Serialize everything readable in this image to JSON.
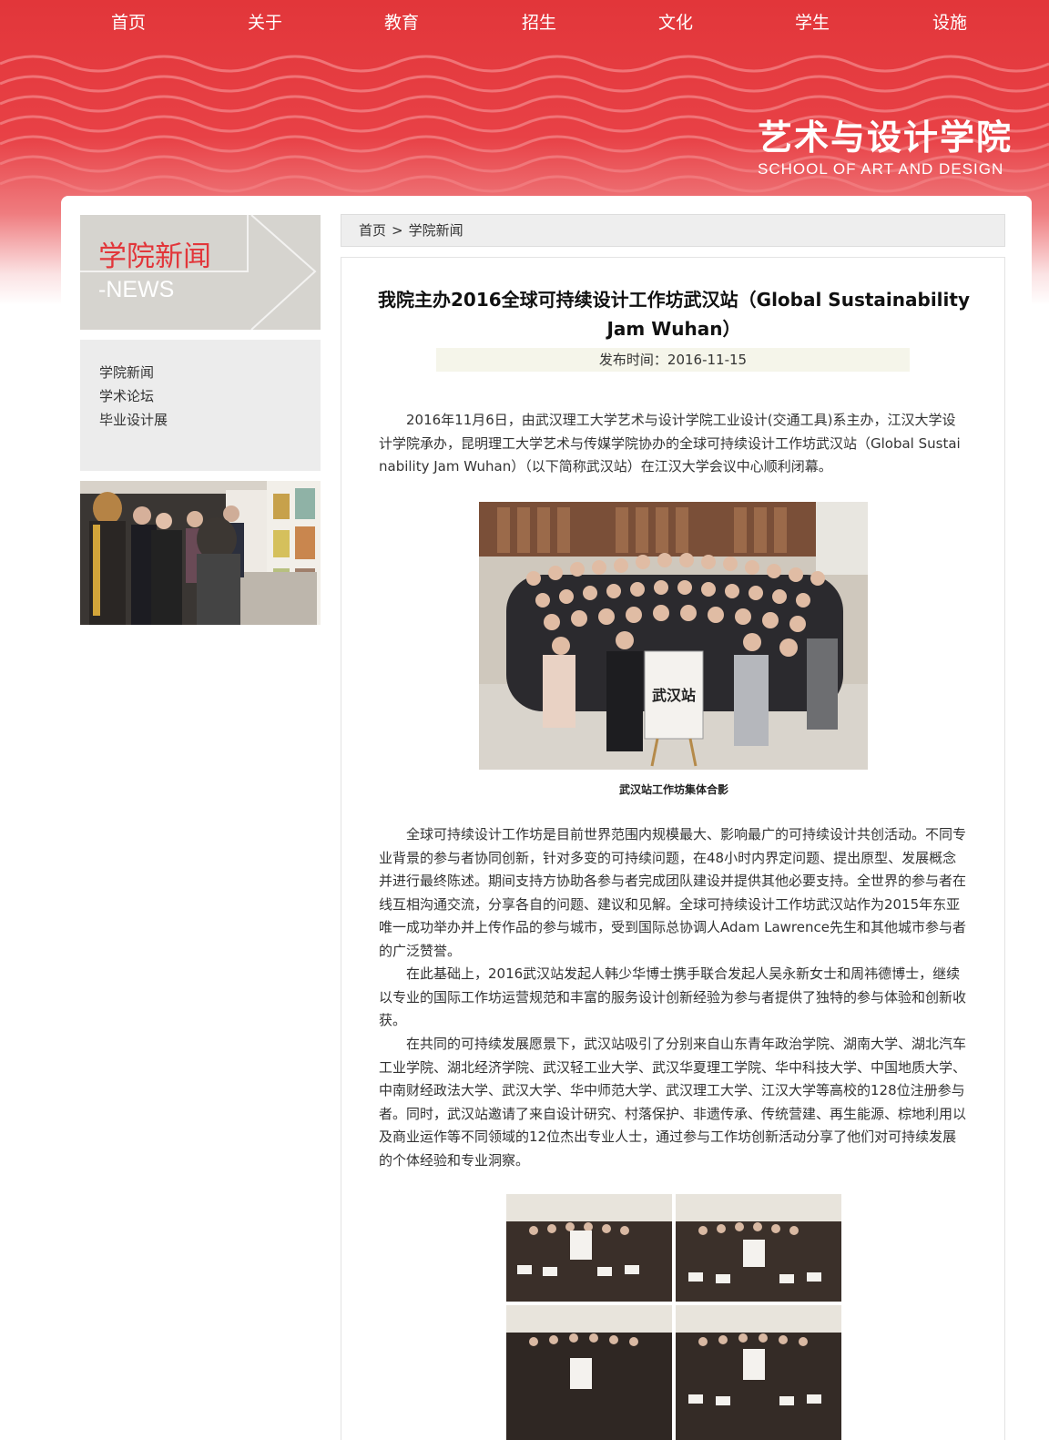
{
  "nav": {
    "items": [
      "首页",
      "关于",
      "教育",
      "招生",
      "文化",
      "学生",
      "设施"
    ]
  },
  "logo": {
    "cn": "艺术与设计学院",
    "en": "SCHOOL OF ART AND DESIGN"
  },
  "sidebar": {
    "title_cn": "学院新闻",
    "title_en": "-NEWS",
    "menu": [
      "学院新闻",
      "学术论坛",
      "毕业设计展"
    ]
  },
  "breadcrumb": {
    "home": "首页",
    "separator": ">",
    "current": "学院新闻"
  },
  "article": {
    "title": "我院主办2016全球可持续设计工作坊武汉站（Global Sustainability Jam Wuhan）",
    "pubdate": "发布时间：2016-11-15",
    "intro": "2016年11月6日，由武汉理工大学艺术与设计学院工业设计(交通工具)系主办，江汉大学设计学院承办，昆明理工大学艺术与传媒学院协办的全球可持续设计工作坊武汉站（Global Sustainability Jam Wuhan）（以下简称武汉站）在江汉大学会议中心顺利闭幕。",
    "photo_caption": "武汉站工作坊集体合影",
    "para1": "全球可持续设计工作坊是目前世界范围内规模最大、影响最广的可持续设计共创活动。不同专业背景的参与者协同创新，针对多变的可持续问题，在48小时内界定问题、提出原型、发展概念并进行最终陈述。期间支持方协助各参与者完成团队建设并提供其他必要支持。全世界的参与者在线互相沟通交流，分享各自的问题、建议和见解。全球可持续设计工作坊武汉站作为2015年东亚唯一成功举办并上传作品的参与城市，受到国际总协调人Adam Lawrence先生和其他城市参与者的广泛赞誉。",
    "para2": "在此基础上，2016武汉站发起人韩少华博士携手联合发起人吴永新女士和周祎德博士，继续以专业的国际工作坊运营规范和丰富的服务设计创新经验为参与者提供了独特的参与体验和创新收获。",
    "para3": "在共同的可持续发展愿景下，武汉站吸引了分别来自山东青年政治学院、湖南大学、湖北汽车工业学院、湖北经济学院、武汉轻工业大学、武汉华夏理工学院、华中科技大学、中国地质大学、中南财经政法大学、武汉大学、华中师范大学、武汉理工大学、江汉大学等高校的128位注册参与者。同时，武汉站邀请了来自设计研究、村落保护、非遗传承、传统营建、再生能源、棕地利用以及商业运作等不同领域的12位杰出专业人士，通过参与工作坊创新活动分享了他们对可持续发展的个体经验和专业洞察。",
    "poster_text": "武汉站"
  },
  "colors": {
    "brand_red": "#e2363a",
    "sidebar_gray": "#d6d4cf"
  }
}
